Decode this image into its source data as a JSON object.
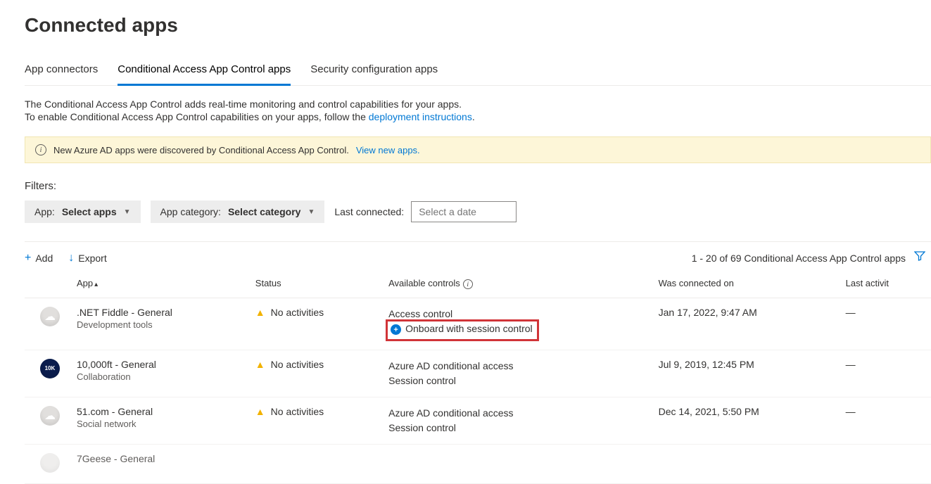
{
  "page_title": "Connected apps",
  "tabs": [
    {
      "label": "App connectors"
    },
    {
      "label": "Conditional Access App Control apps"
    },
    {
      "label": "Security configuration apps"
    }
  ],
  "description": {
    "line1": "The Conditional Access App Control adds real-time monitoring and control capabilities for your apps.",
    "line2_prefix": "To enable Conditional Access App Control capabilities on your apps, follow the ",
    "line2_link": "deployment instructions",
    "line2_suffix": "."
  },
  "banner": {
    "text": "New Azure AD apps were discovered by Conditional Access App Control.",
    "link": "View new apps."
  },
  "filters": {
    "section_label": "Filters:",
    "app": {
      "label": "App:",
      "value": "Select apps"
    },
    "category": {
      "label": "App category:",
      "value": "Select category"
    },
    "last_connected": {
      "label": "Last connected:",
      "placeholder": "Select a date"
    }
  },
  "toolbar": {
    "add": "Add",
    "export": "Export",
    "count_text": "1 - 20 of 69 Conditional Access App Control apps"
  },
  "columns": {
    "app": "App",
    "status": "Status",
    "controls": "Available controls",
    "connected": "Was connected on",
    "activity": "Last activit"
  },
  "rows": [
    {
      "icon_type": "cloud",
      "name": ".NET Fiddle - General",
      "category": "Development tools",
      "status": "No activities",
      "controls_line1": "Access control",
      "controls_line2": "Onboard with session control",
      "controls_line2_has_plus": true,
      "controls_line2_highlight": true,
      "connected": "Jan 17, 2022, 9:47 AM",
      "activity": "—"
    },
    {
      "icon_type": "dark10k",
      "name": "10,000ft - General",
      "category": "Collaboration",
      "status": "No activities",
      "controls_line1": "Azure AD conditional access",
      "controls_line2": "Session control",
      "controls_line2_has_plus": false,
      "controls_line2_highlight": false,
      "connected": "Jul 9, 2019, 12:45 PM",
      "activity": "—"
    },
    {
      "icon_type": "cloud",
      "name": "51.com - General",
      "category": "Social network",
      "status": "No activities",
      "controls_line1": "Azure AD conditional access",
      "controls_line2": "Session control",
      "controls_line2_has_plus": false,
      "controls_line2_highlight": false,
      "connected": "Dec 14, 2021, 5:50 PM",
      "activity": "—"
    }
  ],
  "cutoff_row": {
    "name": "7Geese - General"
  }
}
